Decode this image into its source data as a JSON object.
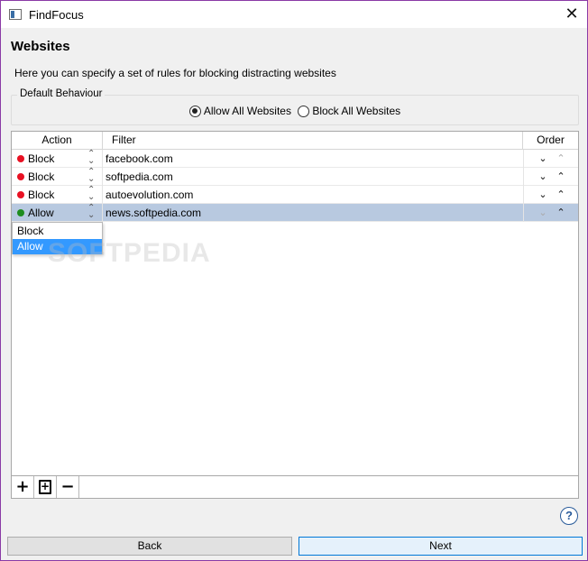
{
  "window": {
    "title": "FindFocus",
    "close_glyph": "✕"
  },
  "page": {
    "title": "Websites",
    "description": "Here you can specify a set of rules for blocking distracting websites"
  },
  "default_behaviour": {
    "label": "Default Behaviour",
    "options": [
      {
        "label": "Allow All Websites",
        "checked": true
      },
      {
        "label": "Block All Websites",
        "checked": false
      }
    ]
  },
  "table": {
    "columns": {
      "action": "Action",
      "filter": "Filter",
      "order": "Order"
    },
    "rows": [
      {
        "action": "Block",
        "status_color": "#e81123",
        "filter": "facebook.com",
        "selected": false
      },
      {
        "action": "Block",
        "status_color": "#e81123",
        "filter": "softpedia.com",
        "selected": false
      },
      {
        "action": "Block",
        "status_color": "#e81123",
        "filter": "autoevolution.com",
        "selected": false
      },
      {
        "action": "Allow",
        "status_color": "#1e8c1e",
        "filter": "news.softpedia.com",
        "selected": true
      }
    ]
  },
  "dropdown": {
    "options": [
      "Block",
      "Allow"
    ],
    "highlighted": "Allow"
  },
  "watermark": "SOFTPEDIA",
  "toolbar": {
    "add_glyph": "+",
    "add_copy_glyph": "+",
    "remove_glyph": "−"
  },
  "help": {
    "glyph": "?"
  },
  "buttons": {
    "back": "Back",
    "next": "Next"
  },
  "colors": {
    "selection": "#b8c9e0",
    "dropdown_highlight": "#3399ff",
    "window_border": "#8a3aa6"
  }
}
